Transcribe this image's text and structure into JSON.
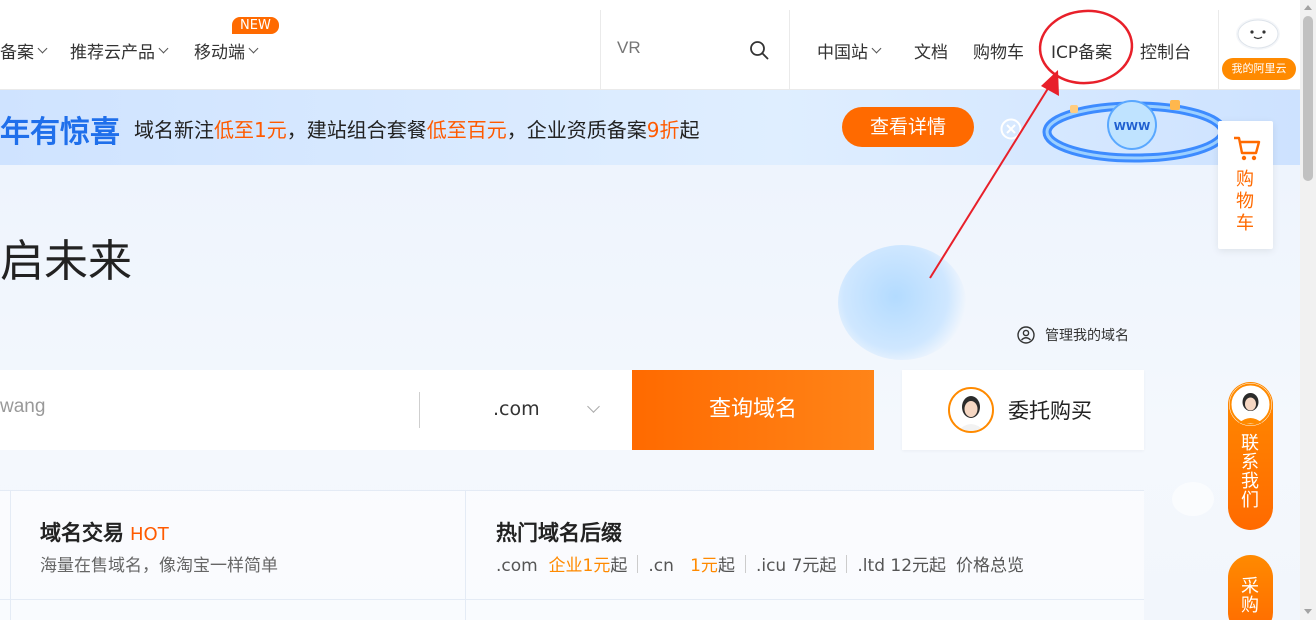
{
  "nav": {
    "items": [
      {
        "label": "备案"
      },
      {
        "label": "推荐云产品"
      },
      {
        "label": "移动端"
      }
    ],
    "new_badge": "NEW",
    "search_placeholder": "VR",
    "site_label": "中国站",
    "docs_label": "文档",
    "cart_label": "购物车",
    "icp_label": "ICP备案",
    "console_label": "控制台",
    "avatar_label": "我的阿里云"
  },
  "promo": {
    "headline": "年有惊喜",
    "text_1": "域名新注",
    "hl_1": "低至1元",
    "text_2": "，建站组合套餐",
    "hl_2": "低至百元",
    "text_3": "，企业资质备案",
    "hl_3": "9折",
    "text_4": "起",
    "button": "查看详情",
    "art_text": "WWW"
  },
  "hero": {
    "title": "启未来",
    "manage_label": "管理我的域名",
    "domain_input_value": "wang",
    "tld_value": ".com",
    "query_button": "查询域名",
    "entrust_button": "委托购买"
  },
  "cards": {
    "trade_title": "域名交易",
    "trade_badge": "HOT",
    "trade_sub": "海量在售域名，像淘宝一样简单",
    "hot_title": "热门域名后缀",
    "suffixes": {
      "com": ".com",
      "com_price_hl": "企业1元",
      "qi": "起",
      "cn": ".cn",
      "cn_price_hl": "1元",
      "icu": ".icu 7元起",
      "ltd": ".ltd 12元起",
      "overview": "价格总览"
    }
  },
  "float": {
    "cart": "购物车",
    "contact": "联系我们",
    "buy": "采购"
  },
  "colors": {
    "accent": "#ff6a00",
    "brand_blue": "#1f6feb",
    "annotation_red": "#e8202a"
  }
}
